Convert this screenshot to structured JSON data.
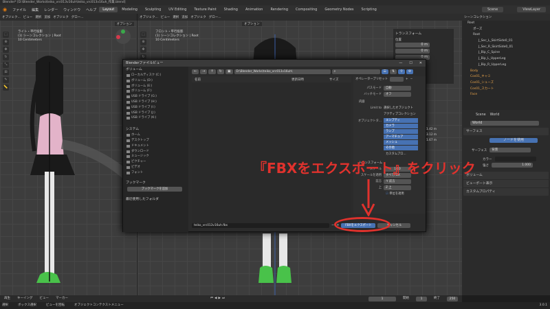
{
  "window": {
    "title": "Blender* [D:\\Blender_Works\\teiko_vrc013v16uh\\teiko_vrc013v16uh_作業.blend]"
  },
  "menu": {
    "items": [
      "ファイル",
      "編集",
      "レンダー",
      "ウィンドウ",
      "ヘルプ"
    ],
    "workspaces": [
      "Layout",
      "Modeling",
      "Sculpting",
      "UV Editing",
      "Texture Paint",
      "Shading",
      "Animation",
      "Rendering",
      "Compositing",
      "Geometry Nodes",
      "Scripting"
    ],
    "scene_label": "Scene",
    "viewlayer_label": "ViewLayer"
  },
  "viewport_left": {
    "header": [
      "オブジェク...",
      "ビュー",
      "選択",
      "追加",
      "オブジェク",
      "グロー..."
    ],
    "option": "オプション",
    "info": [
      "ライト・平行投影",
      "(1) シーンコレクション | Root",
      "10 Centimeters"
    ]
  },
  "viewport_right": {
    "header": [
      "オブジェク...",
      "ビュー",
      "選択",
      "追加",
      "オブジェク",
      "グロー..."
    ],
    "option": "オプション",
    "info": [
      "フロント・平行投影",
      "(1) シーンコレクション | Root",
      "10 Centimeters"
    ]
  },
  "npanel": {
    "title": "トランスフォーム",
    "location": "位置",
    "values": [
      "0 m",
      "0 m",
      "0 m"
    ]
  },
  "outliner": {
    "header": "シーンコレクション",
    "items": [
      "Root",
      "ポーズ",
      "Root",
      "J_Sec_L_SkirtSide0_01",
      "J_Sec_R_SkirtSide0_01",
      "J_Bip_C_Spine",
      "J_Bip_L_UpperLeg",
      "J_Bip_R_UpperLeg",
      "Body",
      "Cos01_キャミ",
      "Cos01_シューズ",
      "Cos01_スカート",
      "Face"
    ]
  },
  "properties": {
    "tabs": [
      "Scene",
      "World"
    ],
    "world": "World",
    "surface_label": "サーフェス",
    "use_nodes": "ノードを使用",
    "surface_field": "サーフェス",
    "surface_value": "背景",
    "color_label": "カラー",
    "strength_label": "強さ",
    "strength_value": "1.000",
    "sections": [
      "ボリューム",
      "ビューポート表示",
      "カスタムプロパティ"
    ]
  },
  "dialog": {
    "title": "Blenderファイルビュー",
    "path": "D:\\Blender_Works\\teiko_vrc013v16uh\\",
    "volumes_header": "ボリューム",
    "volumes": [
      "ローカルディスク (C:)",
      "ボリューム (D:)",
      "ボリューム (E:)",
      "ボリューム (F:)",
      "USB ドライブ (G:)",
      "USB ドライブ (H:)",
      "USB ドライブ (I:)",
      "USB ドライブ (J:)",
      "USB ドライブ (K:)"
    ],
    "system_header": "システム",
    "system": [
      "ホーム",
      "デスクトップ",
      "ドキュメント",
      "ダウンロード",
      "ミュージック",
      "ピクチャー",
      "ビデオ",
      "フォント"
    ],
    "bookmarks_header": "ブックマーク",
    "add_bookmark": "ブックマークを追加",
    "recent_header": "最近使用したフォルダ",
    "col_name": "名前",
    "col_date": "更新日時",
    "col_size": "サイズ",
    "filename": "teiko_vrc013v16uh.fbx",
    "export_button": "FBXをエクスポート",
    "cancel_button": "キャンセル",
    "preset_label": "オペレータープリセット",
    "path_mode_label": "パスモード",
    "path_mode": "自動",
    "batch_label": "バッチモード",
    "batch": "オフ",
    "include_header": "内容",
    "limit_label": "Limit to",
    "limit_opts": [
      "選択したオブジェクト",
      "アクティブコレクション"
    ],
    "obj_types_label": "オブジェクトタ...",
    "obj_types": [
      "エンプティ",
      "カメラ",
      "ランプ",
      "アーマチュア",
      "メッシュ",
      "その他"
    ],
    "custom_props": "カスタムプロ...",
    "transform_header": "トランスフォーム",
    "scale_label": "スケール",
    "scale": "1.00",
    "apply_scale_label": "スケールを適用",
    "apply_scale": "すべてFBX",
    "forward_label": "前方",
    "forward": "-Y 前方",
    "up_label": "上",
    "up": "Z 上",
    "apply_unit": "単位を適用",
    "dims": [
      "1.42 m",
      "3.12 m",
      "1.67 m"
    ]
  },
  "annotation": {
    "text": "『FBXをエクスポート』をクリック"
  },
  "timeline": {
    "items": [
      "再生",
      "キーイング",
      "ビュー",
      "マーカー"
    ],
    "frame": "1",
    "start": "1",
    "end": "250",
    "start_label": "開始",
    "end_label": "終了"
  },
  "status": {
    "items": [
      "選択",
      "ボックス選択",
      "ビューを回転",
      "オブジェクトコンテクストメニュー"
    ],
    "version": "3.0.1"
  },
  "colors": {
    "accent": "#4772b3",
    "annotation": "#e0322d",
    "bg": "#1d1d1d"
  }
}
